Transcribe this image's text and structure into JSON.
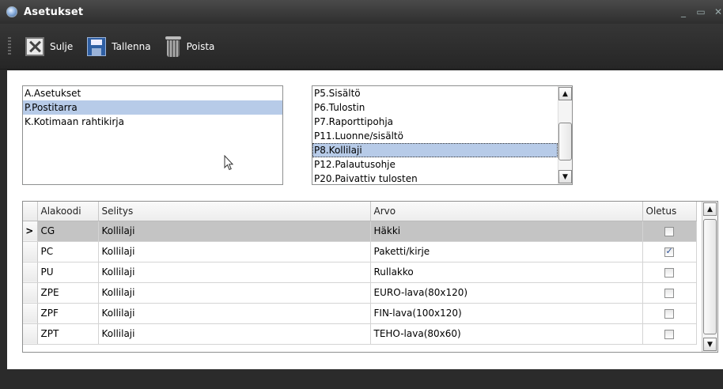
{
  "window": {
    "title": "Asetukset",
    "controls": [
      "_",
      "▭",
      "✕"
    ]
  },
  "toolbar": {
    "close_label": "Sulje",
    "save_label": "Tallenna",
    "delete_label": "Poista"
  },
  "list_left": {
    "items": [
      {
        "label": "A.Asetukset"
      },
      {
        "label": "P.Postitarra",
        "selected": true
      },
      {
        "label": "K.Kotimaan rahtikirja"
      }
    ]
  },
  "list_right": {
    "items": [
      {
        "label": "P5.Sisältö"
      },
      {
        "label": "P6.Tulostin"
      },
      {
        "label": "P7.Raporttipohja"
      },
      {
        "label": "P11.Luonne/sisältö"
      },
      {
        "label": "P8.Kollilaji",
        "selected": true
      },
      {
        "label": "P12.Palautusohje"
      },
      {
        "label": "P20.Paivattiv tulosten"
      }
    ],
    "scroll_up": "▲",
    "scroll_down": "▼"
  },
  "grid": {
    "columns": [
      "Alakoodi",
      "Selitys",
      "Arvo",
      "Oletus"
    ],
    "current_row_marker": ">",
    "rows": [
      {
        "code": "CG",
        "desc": "Kollilaji",
        "value": "Häkki",
        "default": false
      },
      {
        "code": "PC",
        "desc": "Kollilaji",
        "value": "Paketti/kirje",
        "default": true
      },
      {
        "code": "PU",
        "desc": "Kollilaji",
        "value": "Rullakko",
        "default": false
      },
      {
        "code": "ZPE",
        "desc": "Kollilaji",
        "value": "EURO-lava(80x120)",
        "default": false
      },
      {
        "code": "ZPF",
        "desc": "Kollilaji",
        "value": "FIN-lava(100x120)",
        "default": false
      },
      {
        "code": "ZPT",
        "desc": "Kollilaji",
        "value": "TEHO-lava(80x60)",
        "default": false
      }
    ],
    "scroll_up": "▲",
    "scroll_down": "▼"
  }
}
